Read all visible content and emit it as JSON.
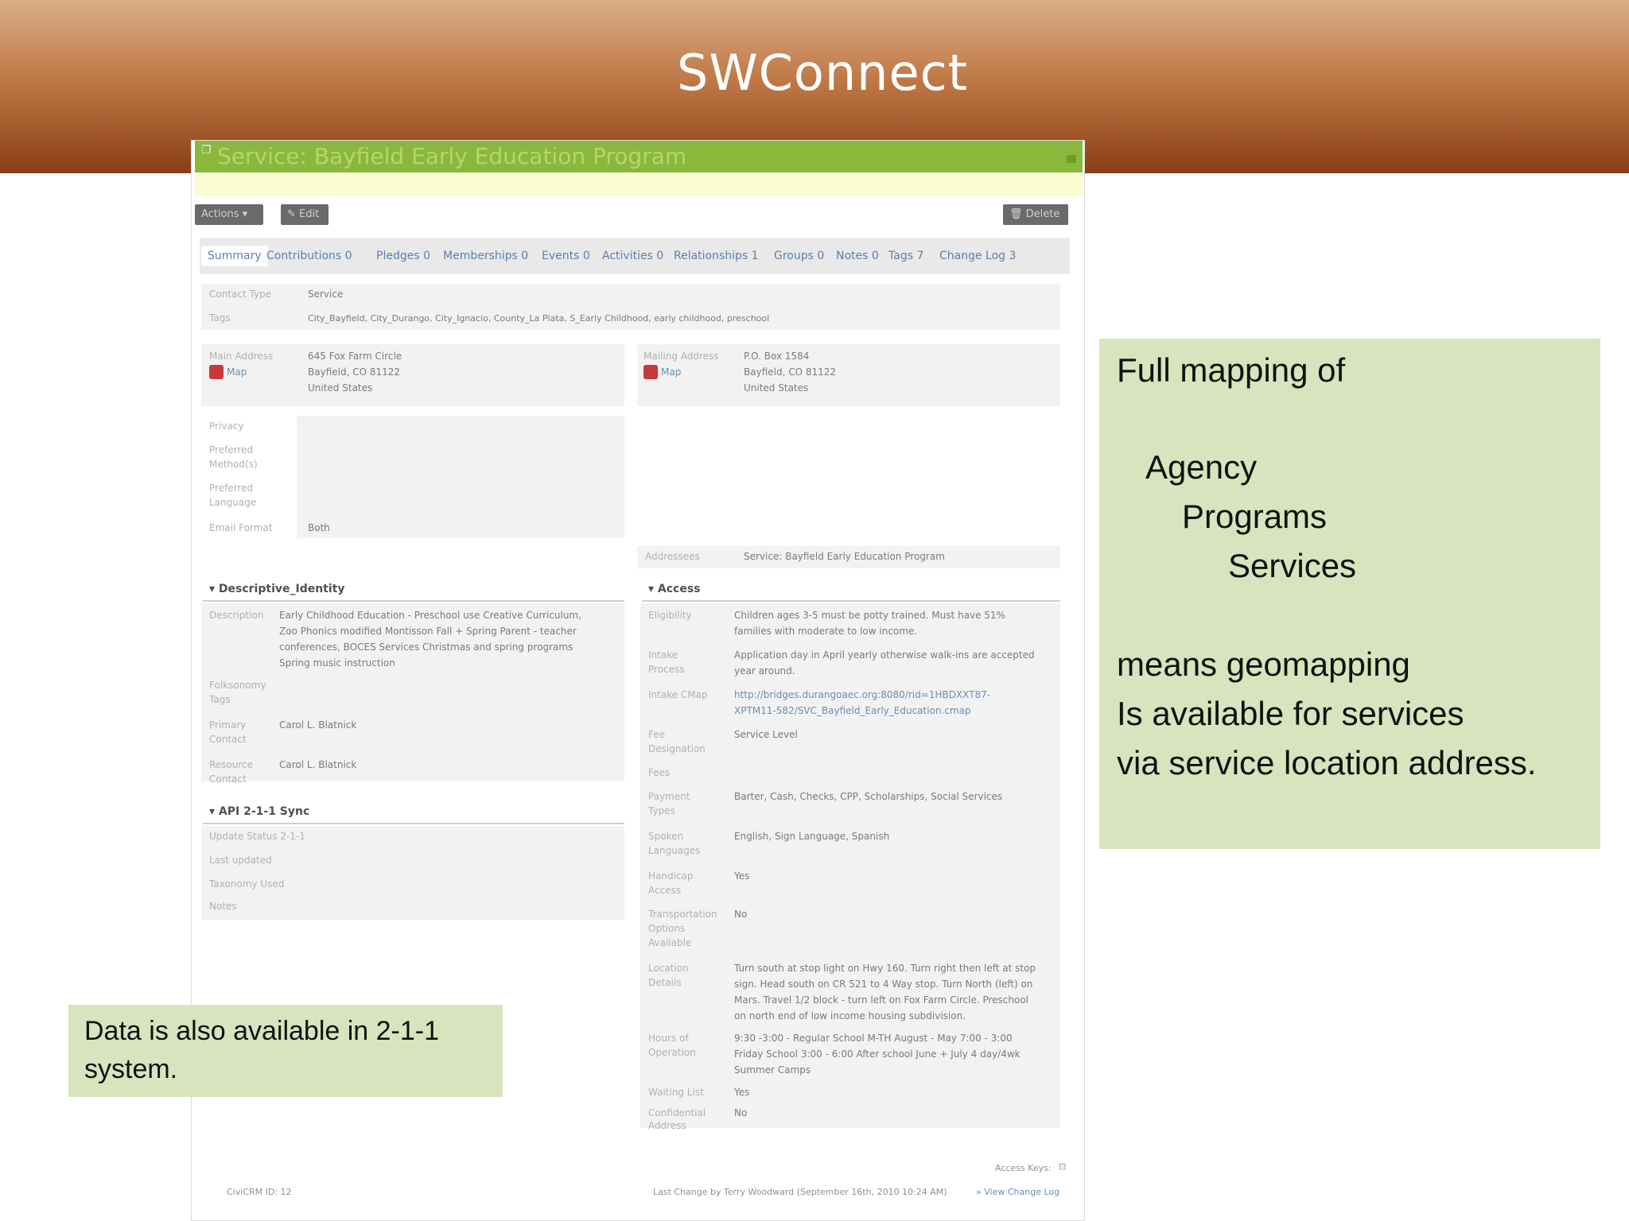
{
  "slide": {
    "title": "SWConnect"
  },
  "screenshot": {
    "page_title": "Service: Bayfield Early Education Program",
    "actions_button": "Actions",
    "edit_button": "Edit",
    "delete_button": "Delete",
    "tabs": [
      {
        "label": "Summary"
      },
      {
        "label": "Contributions 0"
      },
      {
        "label": "Pledges 0"
      },
      {
        "label": "Memberships 0"
      },
      {
        "label": "Events 0"
      },
      {
        "label": "Activities 0"
      },
      {
        "label": "Relationships 1"
      },
      {
        "label": "Groups 0"
      },
      {
        "label": "Notes 0"
      },
      {
        "label": "Tags 7"
      },
      {
        "label": "Change Log 3"
      }
    ],
    "contact_type_label": "Contact Type",
    "contact_type_value": "Service",
    "tags_label": "Tags",
    "tags_value": "City_Bayfield, City_Durango, City_Ignacio, County_La Plata, S_Early Childhood, early childhood, preschool",
    "main_address_label": "Main Address",
    "main_address_map": "Map",
    "main_address_lines": [
      "645 Fox Farm Circle",
      "Bayfield, CO 81122",
      "United States"
    ],
    "mailing_address_label": "Mailing Address",
    "mailing_address_map": "Map",
    "mailing_address_lines": [
      "P.O. Box 1584",
      "Bayfield, CO 81122",
      "United States"
    ],
    "privacy_label": "Privacy",
    "preferred_method_label": [
      "Preferred",
      "Method(s)"
    ],
    "preferred_language_label": [
      "Preferred",
      "Language"
    ],
    "email_format_label": "Email Format",
    "email_format_value": "Both",
    "addressees_label": "Addressees",
    "addressees_value": "Service: Bayfield Early Education Program",
    "descriptive_section": "Descriptive_Identity",
    "description_label": "Description",
    "description_lines": [
      "Early Childhood Education - Preschool use Creative Curriculum,",
      "Zoo Phonics modified Montisson Fall + Spring Parent - teacher",
      "conferences, BOCES Services Christmas and spring programs",
      "Spring music instruction"
    ],
    "folksonomy_label": [
      "Folksonomy",
      "Tags"
    ],
    "primary_contact_label": [
      "Primary",
      "Contact"
    ],
    "primary_contact_value": "Carol L. Blatnick",
    "resource_contact_label": [
      "Resource",
      "Contact"
    ],
    "resource_contact_value": "Carol L. Blatnick",
    "api_section": "API 2-1-1 Sync",
    "api_fields": [
      "Update Status 2-1-1",
      "Last updated",
      "Taxonomy Used",
      "Notes"
    ],
    "access_section": "Access",
    "eligibility_label": "Eligibility",
    "eligibility_lines": [
      "Children ages 3-5 must be potty trained. Must have 51%",
      "families with moderate to low income."
    ],
    "intake_process_label": [
      "Intake",
      "Process"
    ],
    "intake_process_lines": [
      "Application day in April yearly otherwise walk-ins are accepted",
      "year around."
    ],
    "intake_cmap_label": "Intake CMap",
    "intake_cmap_lines": [
      "http://bridges.durangoaec.org:8080/rid=1HBDXXT87-",
      "XPTM11-582/SVC_Bayfield_Early_Education.cmap"
    ],
    "fee_designation_label": [
      "Fee",
      "Designation"
    ],
    "fee_designation_value": "Service Level",
    "fees_label": "Fees",
    "payment_types_label": [
      "Payment",
      "Types"
    ],
    "payment_types_value": "Barter, Cash, Checks, CPP, Scholarships, Social Services",
    "spoken_languages_label": [
      "Spoken",
      "Languages"
    ],
    "spoken_languages_value": "English, Sign Language, Spanish",
    "handicap_label": [
      "Handicap",
      "Access"
    ],
    "handicap_value": "Yes",
    "transportation_label": [
      "Transportation",
      "Options",
      "Available"
    ],
    "transportation_value": "No",
    "location_label": [
      "Location",
      "Details"
    ],
    "location_lines": [
      "Turn south at stop light on Hwy 160. Turn right then left at stop",
      "sign. Head south on CR 521 to 4 Way stop. Turn North (left) on",
      "Mars. Travel 1/2 block - turn left on Fox Farm Circle. Preschool",
      "on north end of low income housing subdivision."
    ],
    "hours_label": [
      "Hours of",
      "Operation"
    ],
    "hours_lines": [
      "9:30 -3:00 - Regular School M-TH August - May 7:00 - 3:00",
      "Friday School 3:00 - 6:00 After school June + July 4 day/4wk",
      "Summer Camps"
    ],
    "waiting_list_label": "Waiting List",
    "waiting_list_value": "Yes",
    "confidential_label": [
      "Confidential",
      "Address"
    ],
    "confidential_value": "No",
    "access_keys": "Access Keys:",
    "civicrm_id": "CiviCRM ID: 12",
    "last_change": "Last Change by Terry Woodward (September 16th, 2010 10:24 AM)",
    "view_change_log": "» View Change Log"
  },
  "callout_right": {
    "line1": "Full mapping of",
    "line2": "Agency",
    "line3": "Programs",
    "line4": "Services",
    "line5": "means geomapping",
    "line6": "Is available for services",
    "line7": "via service location address."
  },
  "callout_left": {
    "line1": "Data is also available in 2-1-1",
    "line2": "system."
  },
  "colors": {
    "banner_top": "#dcae88",
    "banner_bottom": "#8a3e14",
    "callout_bg": "#d7e4bd",
    "title_bar": "#8ab83c"
  }
}
